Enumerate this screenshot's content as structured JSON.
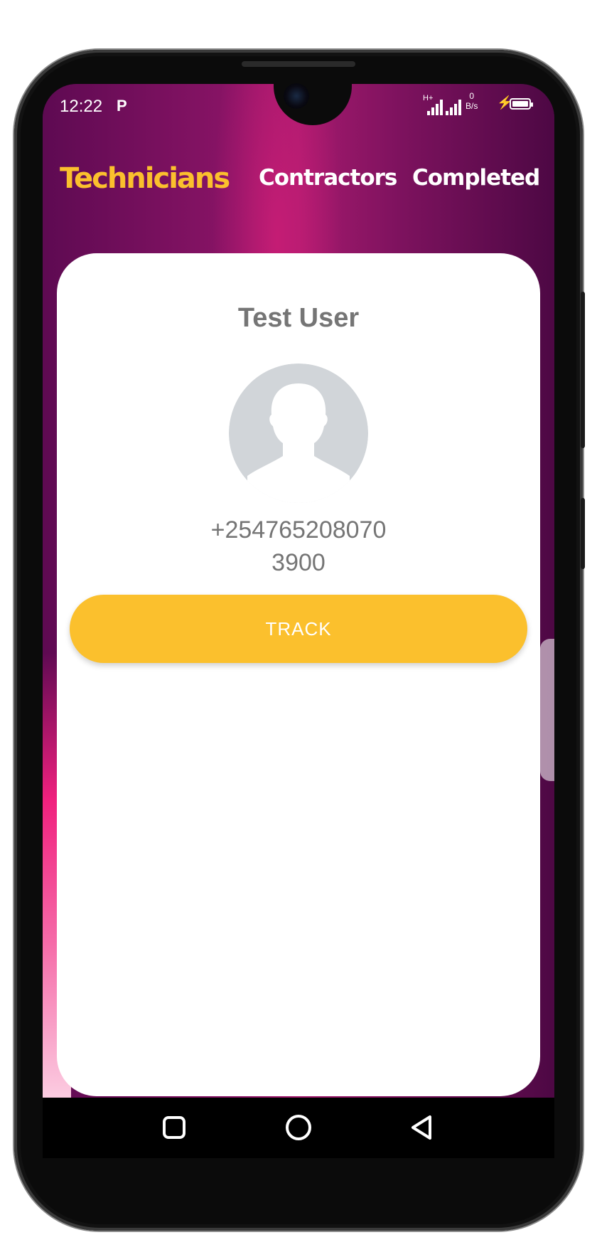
{
  "status_bar": {
    "time": "12:22",
    "app_indicator": "P",
    "network_type": "H+",
    "data_rate_value": "0",
    "data_rate_unit": "B/s"
  },
  "tabs": [
    {
      "label": "Technicians",
      "active": true
    },
    {
      "label": "Contractors",
      "active": false
    },
    {
      "label": "Completed",
      "active": false
    }
  ],
  "technician_card": {
    "name": "Test User",
    "phone": "+254765208070",
    "amount": "3900",
    "track_label": "TRACK",
    "avatar_icon": "person-silhouette-icon"
  },
  "nav_bar": {
    "icons": [
      "square-recents-icon",
      "circle-home-icon",
      "triangle-back-icon"
    ]
  },
  "colors": {
    "accent": "#fbc02d",
    "header_gradient_mid": "#a61a6e",
    "header_gradient_edge": "#5e0a52",
    "card_text": "#757575"
  }
}
